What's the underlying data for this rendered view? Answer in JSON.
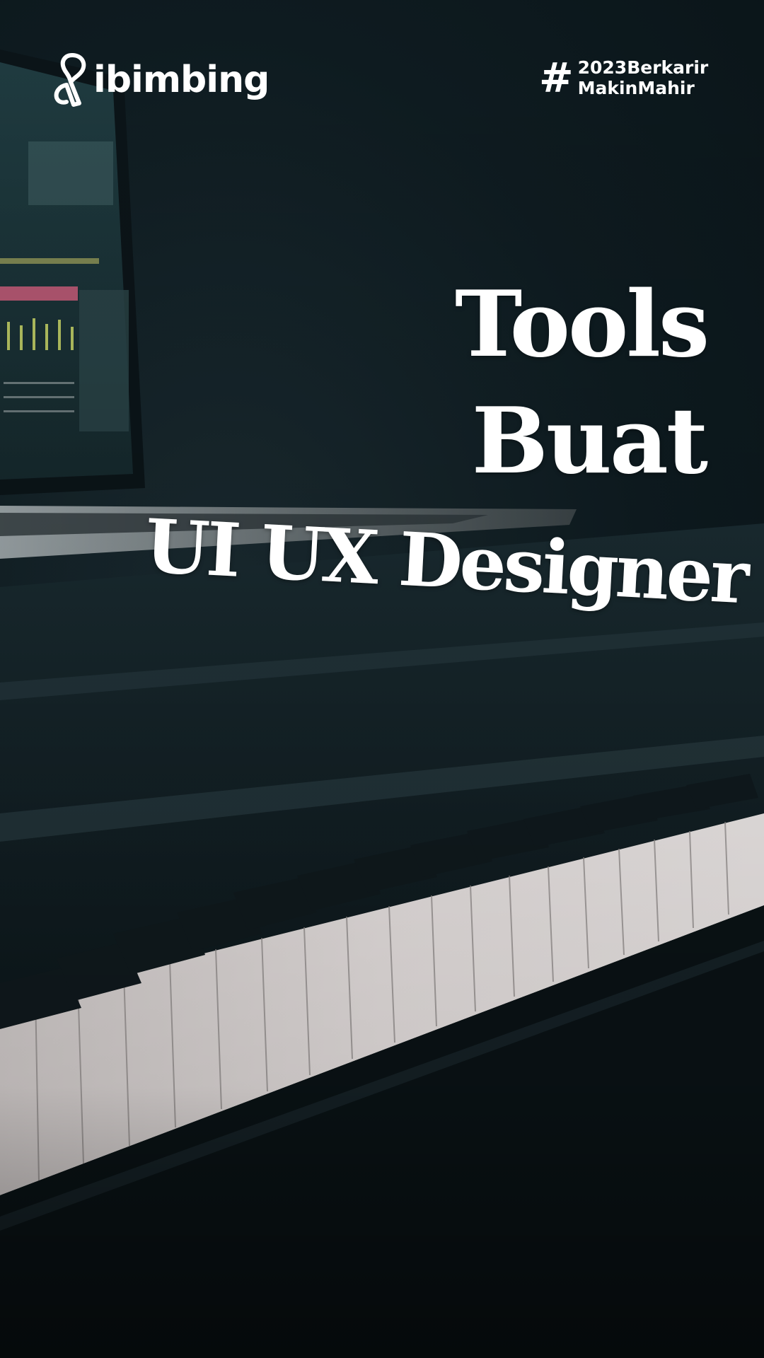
{
  "brand": {
    "logo_text": "ibimbing",
    "hashtag_symbol": "#",
    "hashtag_line1": "2023Berkarir",
    "hashtag_line2": "MakinMahir"
  },
  "headline": {
    "line1": "Tools",
    "line2": "Buat",
    "line3": "UI UX Designer"
  },
  "background": {
    "description_icon": "piano-laptop-photo",
    "base_color": "#0f1d22",
    "key_color": "#e8e4e2",
    "screen_color": "#1e3a3f"
  }
}
